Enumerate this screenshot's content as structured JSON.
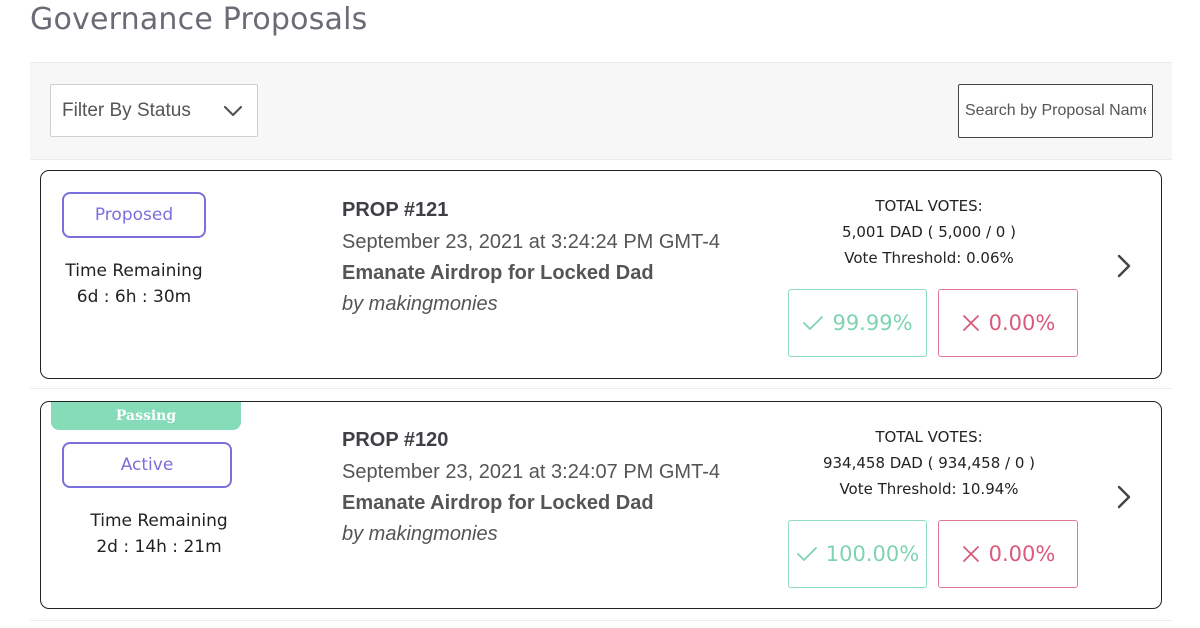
{
  "page": {
    "title": "Governance Proposals"
  },
  "filters": {
    "status_label": "Filter By Status",
    "search_placeholder": "Search by Proposal Name"
  },
  "proposals": [
    {
      "ribbon": "",
      "status": "Proposed",
      "time_label": "Time Remaining",
      "time_value": "6d : 6h : 30m",
      "number": "PROP #121",
      "date": "September 23, 2021 at 3:24:24 PM GMT-4",
      "name": "Emanate Airdrop for Locked Dad",
      "author": "by makingmonies",
      "total_votes_label": "TOTAL VOTES:",
      "total_votes": "5,001 DAD ( 5,000 / 0 )",
      "threshold": "Vote Threshold: 0.06%",
      "for_pct": "99.99%",
      "against_pct": "0.00%"
    },
    {
      "ribbon": "Passing",
      "status": "Active",
      "time_label": "Time Remaining",
      "time_value": "2d : 14h : 21m",
      "number": "PROP #120",
      "date": "September 23, 2021 at 3:24:07 PM GMT-4",
      "name": "Emanate Airdrop for Locked Dad",
      "author": "by makingmonies",
      "total_votes_label": "TOTAL VOTES:",
      "total_votes": "934,458 DAD ( 934,458 / 0 )",
      "threshold": "Vote Threshold: 10.94%",
      "for_pct": "100.00%",
      "against_pct": "0.00%"
    }
  ],
  "colors": {
    "status_purple": "#7b6fdc",
    "passing_green": "#86dcb8",
    "for_green": "#7fd3b1",
    "against_red": "#d85c7a"
  },
  "icons": {
    "filter_chevron": "chevron-down-icon",
    "card_chevron": "chevron-right-icon",
    "for": "check-icon",
    "against": "x-icon"
  }
}
